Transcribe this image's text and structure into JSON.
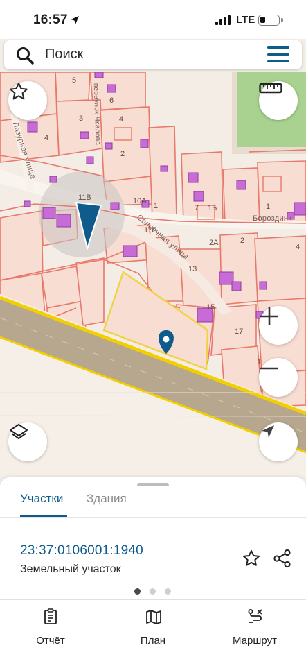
{
  "status_bar": {
    "time": "16:57",
    "network": "LTE"
  },
  "search": {
    "placeholder": "Поиск"
  },
  "map": {
    "house_numbers": [
      "5",
      "6",
      "3",
      "4",
      "4",
      "2",
      "11В",
      "10А",
      "1",
      "7",
      "1Б",
      "1",
      "11Г",
      "2А",
      "2",
      "4",
      "13",
      "15",
      "17",
      "1"
    ],
    "streets": [
      "Лазурная улица",
      "Солнечная улица",
      "Бороздинк",
      "переулок Чкалова"
    ],
    "colors": {
      "parcel_line": "#e8786a",
      "parcel_fill": "#f6d8cf",
      "building": "#c96bd6",
      "road": "#b5a48a",
      "road_edge": "#f2d000",
      "selected": "#f0d24a",
      "park": "#9ecb86",
      "pin": "#0f5c8c"
    }
  },
  "controls": {
    "favorite_icon": "star-outline-icon",
    "ruler_icon": "ruler-icon",
    "zoom_in_icon": "plus-icon",
    "zoom_out_icon": "minus-icon",
    "layers_icon": "layers-icon",
    "locate_icon": "navigation-arrow-icon"
  },
  "sheet": {
    "tabs": [
      {
        "label": "Участки",
        "active": true
      },
      {
        "label": "Здания",
        "active": false
      }
    ],
    "parcel": {
      "number": "23:37:0106001:1940",
      "type": "Земельный участок"
    },
    "pager": {
      "count": 3,
      "active": 1
    }
  },
  "bottom_nav": [
    {
      "label": "Отчёт",
      "icon": "report-icon"
    },
    {
      "label": "План",
      "icon": "map-plan-icon"
    },
    {
      "label": "Маршрут",
      "icon": "route-icon"
    }
  ]
}
